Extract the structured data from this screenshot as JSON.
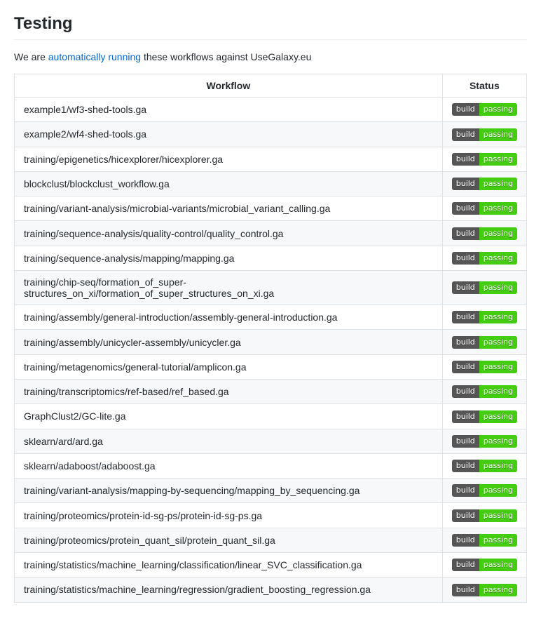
{
  "heading": "Testing",
  "intro": {
    "prefix": "We are ",
    "link_text": "automatically running",
    "suffix": " these workflows against UseGalaxy.eu"
  },
  "table": {
    "headers": {
      "workflow": "Workflow",
      "status": "Status"
    },
    "badge": {
      "left": "build",
      "right": "passing"
    },
    "rows": [
      {
        "workflow": "example1/wf3-shed-tools.ga"
      },
      {
        "workflow": "example2/wf4-shed-tools.ga"
      },
      {
        "workflow": "training/epigenetics/hicexplorer/hicexplorer.ga"
      },
      {
        "workflow": "blockclust/blockclust_workflow.ga"
      },
      {
        "workflow": "training/variant-analysis/microbial-variants/microbial_variant_calling.ga"
      },
      {
        "workflow": "training/sequence-analysis/quality-control/quality_control.ga"
      },
      {
        "workflow": "training/sequence-analysis/mapping/mapping.ga"
      },
      {
        "workflow": "training/chip-seq/formation_of_super-structures_on_xi/formation_of_super_structures_on_xi.ga"
      },
      {
        "workflow": "training/assembly/general-introduction/assembly-general-introduction.ga"
      },
      {
        "workflow": "training/assembly/unicycler-assembly/unicycler.ga"
      },
      {
        "workflow": "training/metagenomics/general-tutorial/amplicon.ga"
      },
      {
        "workflow": "training/transcriptomics/ref-based/ref_based.ga"
      },
      {
        "workflow": "GraphClust2/GC-lite.ga"
      },
      {
        "workflow": "sklearn/ard/ard.ga"
      },
      {
        "workflow": "sklearn/adaboost/adaboost.ga"
      },
      {
        "workflow": "training/variant-analysis/mapping-by-sequencing/mapping_by_sequencing.ga"
      },
      {
        "workflow": "training/proteomics/protein-id-sg-ps/protein-id-sg-ps.ga"
      },
      {
        "workflow": "training/proteomics/protein_quant_sil/protein_quant_sil.ga"
      },
      {
        "workflow": "training/statistics/machine_learning/classification/linear_SVC_classification.ga"
      },
      {
        "workflow": "training/statistics/machine_learning/regression/gradient_boosting_regression.ga"
      }
    ]
  }
}
